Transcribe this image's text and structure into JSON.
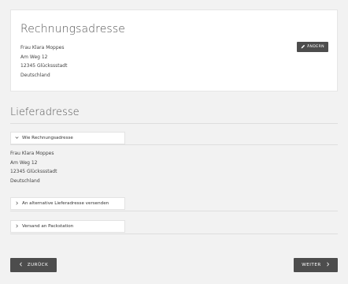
{
  "billing": {
    "title": "Rechnungsadresse",
    "name": "Frau Klara Moppes",
    "street": "Am Weg 12",
    "city": "12345 Glückssstadt",
    "country": "Deutschland",
    "change_label": "ÄNDERN",
    "change_icon": "pencil-icon"
  },
  "delivery": {
    "title": "Lieferadresse",
    "same_as_billing_label": "Wie Rechnungsadresse",
    "name": "Frau Klara Moppes",
    "street": "Am Weg 12",
    "city": "12345 Glückssstadt",
    "country": "Deutschland",
    "alternative_label": "An alternative Lieferadresse versenden",
    "packstation_label": "Versand an Packstation"
  },
  "footer": {
    "back_label": "ZURÜCK",
    "next_label": "WEITER"
  },
  "colors": {
    "background": "#f2f2f2",
    "card": "#ffffff",
    "button": "#4d4d4d",
    "button_text": "#ffffff"
  }
}
